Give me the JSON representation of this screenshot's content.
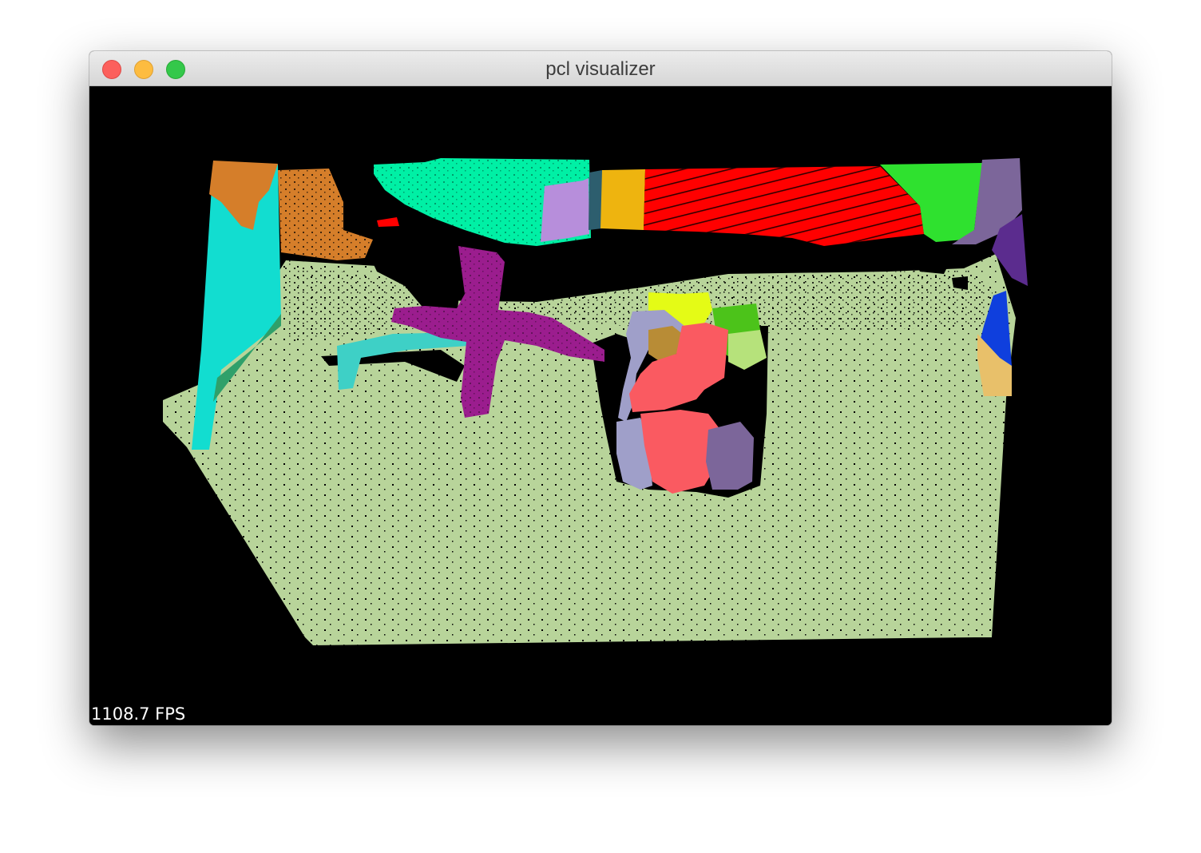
{
  "window": {
    "title": "pcl visualizer"
  },
  "viewport": {
    "background": "#000000",
    "fps_text": "1108.7 FPS",
    "segment_colors": {
      "floor": "#b8d49a",
      "cyan_wall": "#12ddd0",
      "orange_wall": "#d57e2a",
      "mint_block": "#00f0a5",
      "lavender": "#b78edb",
      "slate": "#2d5e6e",
      "amber": "#eeb40f",
      "red_wall": "#ff0000",
      "green_wall": "#2fe12f",
      "purple_dark": "#5b2c8e",
      "magenta_chair": "#9b1d8e",
      "turquoise_leg": "#3ed0c6",
      "salmon": "#fa5a61",
      "periwinkle": "#9f9fc9",
      "plum": "#7c669a",
      "yellow": "#e4fb16",
      "leaf_green": "#4cc31a",
      "pale_green": "#b6e27b",
      "ochre": "#b88c36",
      "blue": "#0f3fdd",
      "sand": "#e8c06a"
    }
  }
}
